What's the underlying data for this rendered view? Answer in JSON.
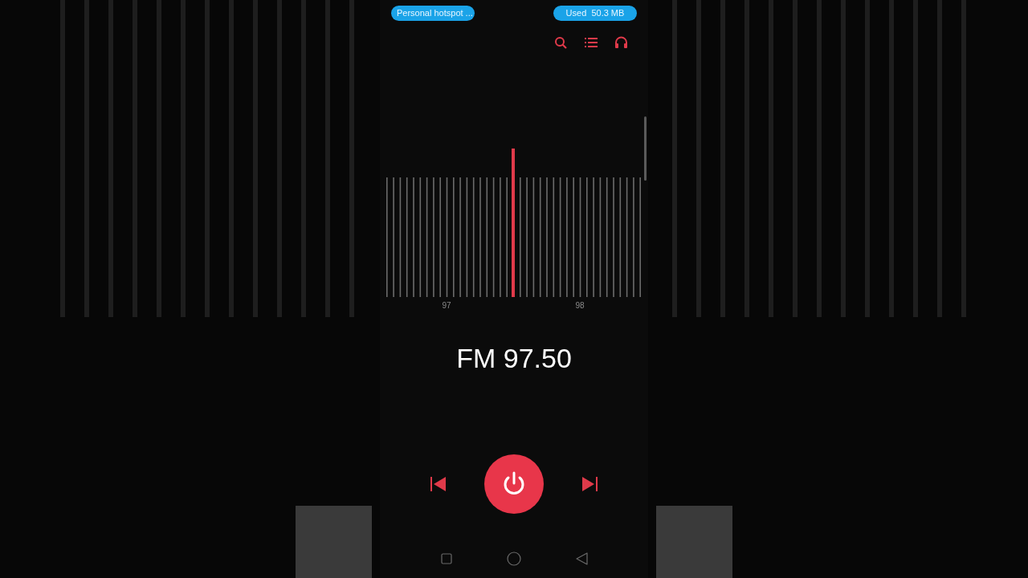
{
  "status_pills": [
    {
      "text": "Personal hotspot ..."
    },
    {
      "text": "Used  50.3 MB"
    }
  ],
  "dial": {
    "labels": [
      "97",
      "98"
    ]
  },
  "frequency": "FM 97.50"
}
